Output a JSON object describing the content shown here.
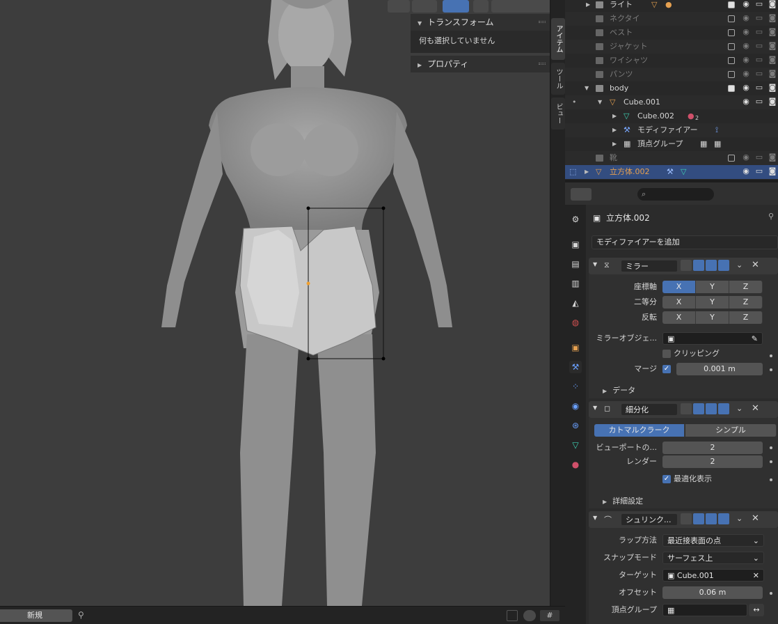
{
  "viewport": {
    "bottom_new_button": "新規"
  },
  "npanel": {
    "transform_header": "トランスフォーム",
    "nothing_selected": "何も選択していません",
    "properties_header": "プロパティ",
    "tabs": [
      "アイテム",
      "ツール",
      "ビュー"
    ]
  },
  "outliner": {
    "rows": [
      {
        "label": "ライト"
      },
      {
        "label": "ネクタイ"
      },
      {
        "label": "ベスト"
      },
      {
        "label": "ジャケット"
      },
      {
        "label": "ワイシャツ"
      },
      {
        "label": "パンツ"
      },
      {
        "label": "body"
      },
      {
        "label": "Cube.001"
      },
      {
        "label": "Cube.002"
      },
      {
        "label": "モディファイアー"
      },
      {
        "label": "頂点グループ"
      },
      {
        "label": "靴"
      },
      {
        "label": "立方体.002"
      }
    ],
    "badge_count": "2"
  },
  "properties": {
    "object_name": "立方体.002",
    "add_modifier": "モディファイアーを追加",
    "mirror": {
      "name": "ミラー",
      "axis_label": "座標軸",
      "bisect_label": "二等分",
      "flip_label": "反転",
      "x": "X",
      "y": "Y",
      "z": "Z",
      "mirror_object_label": "ミラーオブジェ...",
      "clipping_label": "クリッピング",
      "merge_label": "マージ",
      "merge_value": "0.001 m",
      "data_label": "データ"
    },
    "subdivision": {
      "name": "細分化",
      "catmull": "カトマルクラーク",
      "simple": "シンプル",
      "viewport_label": "ビューポートの...",
      "viewport_value": "2",
      "render_label": "レンダー",
      "render_value": "2",
      "optimal_label": "最適化表示",
      "advanced_label": "詳細設定"
    },
    "shrinkwrap": {
      "name": "シュリンク...",
      "wrap_method_label": "ラップ方法",
      "wrap_method_value": "最近接表面の点",
      "snap_mode_label": "スナップモード",
      "snap_mode_value": "サーフェス上",
      "target_label": "ターゲット",
      "target_value": "Cube.001",
      "offset_label": "オフセット",
      "offset_value": "0.06 m",
      "vertex_group_label": "頂点グループ"
    }
  },
  "colors": {
    "accent": "#4772b3",
    "selected_row": "#334d80",
    "mesh_orange": "#e5a050",
    "mesh_teal": "#3fd2b4"
  }
}
